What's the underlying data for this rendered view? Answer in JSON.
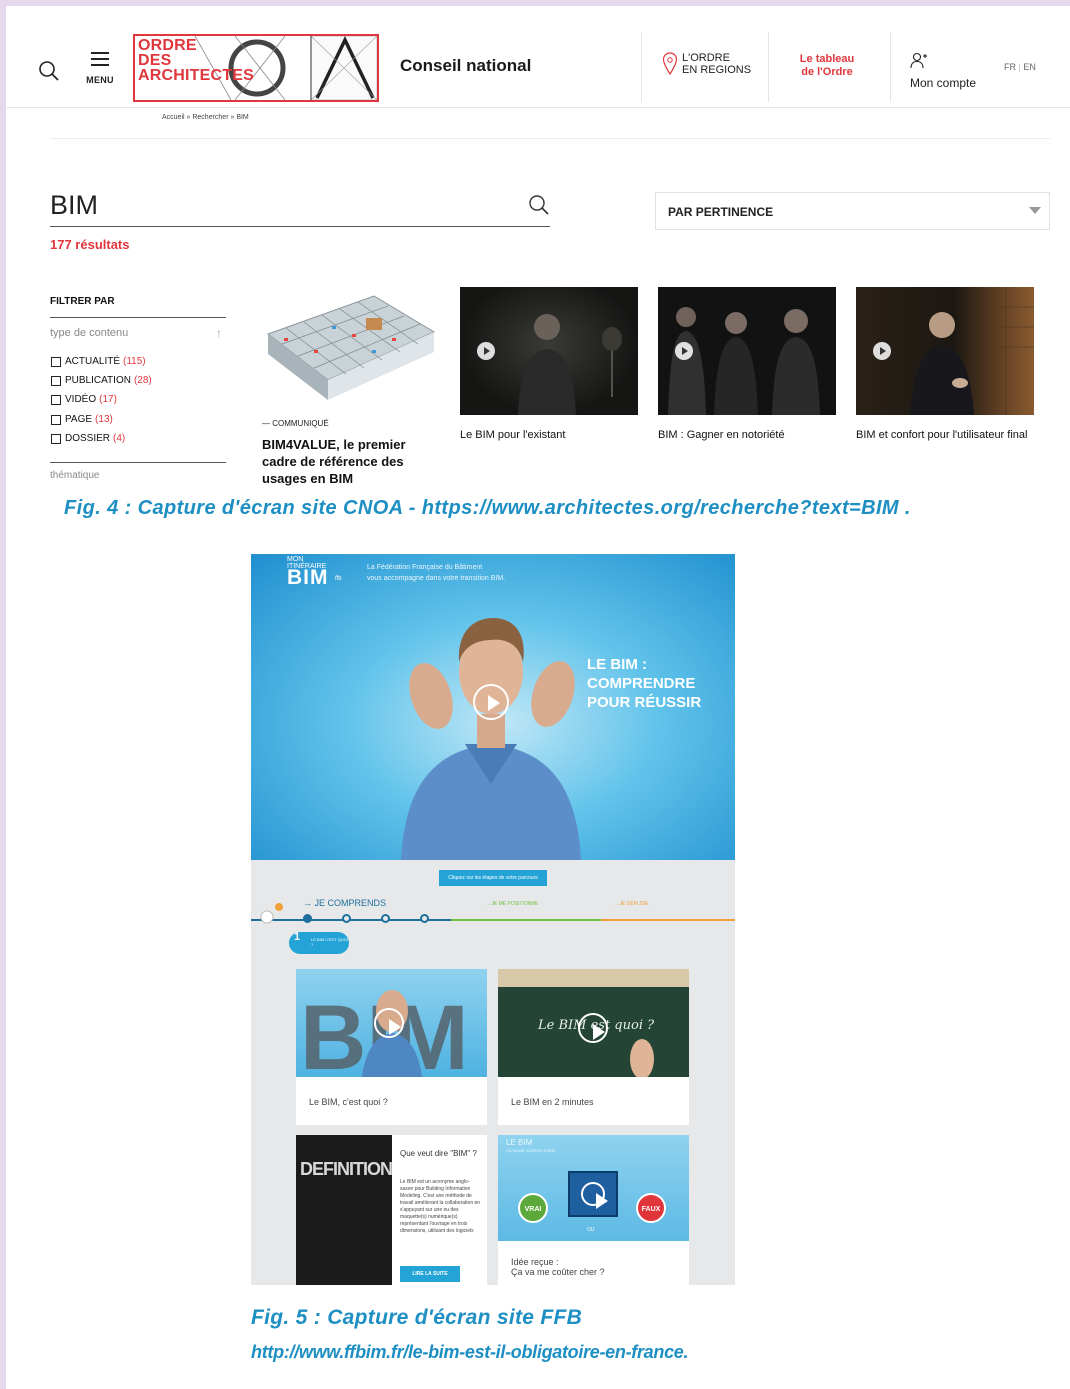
{
  "fig4": {
    "header": {
      "menu_label": "MENU",
      "logo_text": "ORDRE\nDES\nARCHITECTES",
      "site_title": "Conseil national",
      "regions_label": "L'ORDRE\nEN REGIONS",
      "tableau_label": "Le tableau\nde l'Ordre",
      "account_label": "Mon compte",
      "lang_fr": "FR",
      "lang_sep": "|",
      "lang_en": "EN"
    },
    "breadcrumb": "Accueil » Rechercher » BIM",
    "search": {
      "query": "BIM",
      "sort_label": "PAR PERTINENCE",
      "results_count": "177 résultats"
    },
    "filters": {
      "title": "FILTRER PAR",
      "group_label": "type de contenu",
      "options": [
        {
          "label": "ACTUALITÉ",
          "count": "(115)"
        },
        {
          "label": "PUBLICATION",
          "count": "(28)"
        },
        {
          "label": "VIDÉO",
          "count": "(17)"
        },
        {
          "label": "PAGE",
          "count": "(13)"
        },
        {
          "label": "DOSSIER",
          "count": "(4)"
        }
      ],
      "next_group": "thématique"
    },
    "results": {
      "first": {
        "kicker": "— COMMUNIQUÉ",
        "title": "BIM4VALUE, le premier cadre de référence des usages en BIM"
      },
      "videos": [
        {
          "title": "Le BIM pour l'existant"
        },
        {
          "title": "BIM : Gagner en notoriété"
        },
        {
          "title": "BIM et confort pour l'utilisateur final"
        }
      ]
    },
    "caption": "Fig. 4 :  Capture d'écran site CNOA - https://www.architectes.org/recherche?text=BIM ."
  },
  "fig5": {
    "hero": {
      "brand_top": "MON\nITINÉRAIRE",
      "brand": "BIM",
      "brand_small": "ffb",
      "intro": "La Fédération Française du Bâtiment\nvous accompagne dans votre transition BIM.",
      "title": "LE BIM :\nCOMPRENDRE\nPOUR RÉUSSIR"
    },
    "steps_button": "Cliquez sur les étapes de votre parcours",
    "timeline": {
      "stage1": "→ JE COMPRENDS",
      "stage2": "→ JE ME POSITIONNE",
      "stage3": "→ JE DÉPLOIE",
      "step_number": "1",
      "step_label": "LE BIM C'EST QUOI ?"
    },
    "cards": [
      {
        "caption": "Le BIM, c'est quoi ?"
      },
      {
        "caption": "Le BIM en 2 minutes",
        "board_text": "Le BIM est quoi ?"
      },
      {
        "image_word": "DEFINITION",
        "title": "Que veut dire \"BIM\" ?",
        "body": "Le BIM est un acronyme anglo-saxon pour Building Information Modeling. C'est une méthode de travail améliorant la collaboration en s'appuyant sur une ou des maquette(s) numérique(s) représentant l'ouvrage en trois dimensions, utilisant des logiciels",
        "button": "LIRE LA SUITE"
      },
      {
        "quiz_title": "LE BIM",
        "quiz_sub": "ÇA VA ME COÛTER CHER",
        "true_label": "VRAI",
        "or_label": "OU",
        "false_label": "FAUX",
        "caption": "Idée reçue :\nÇa va me coûter cher ?"
      }
    ],
    "caption_line1": "Fig. 5 :  Capture d'écran site FFB",
    "caption_line2": "http://www.ffbim.fr/le-bim-est-il-obligatoire-en-france."
  },
  "colors": {
    "brand_red": "#e0363c",
    "caption_blue": "#1d8fc3",
    "ffb_blue": "#24a3d6",
    "frame": "#e4d8ea"
  }
}
